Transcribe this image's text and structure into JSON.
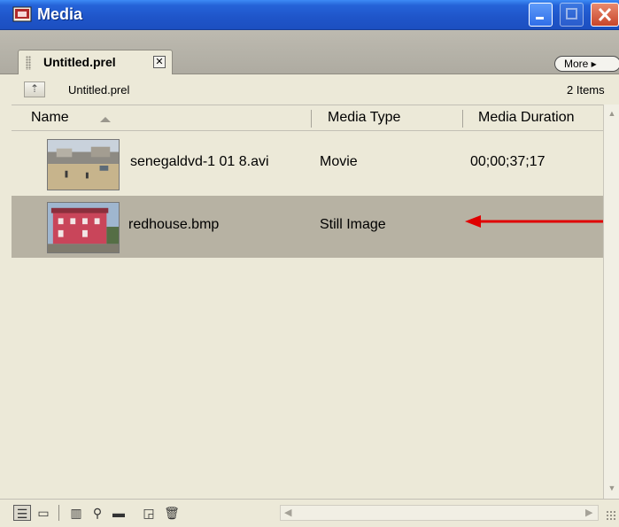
{
  "window": {
    "title": "Media"
  },
  "tabs": [
    {
      "label": "Untitled.prel",
      "close": "✕"
    }
  ],
  "menu": {
    "more_label": "More ▸"
  },
  "location": {
    "path": "Untitled.prel",
    "item_count": "2 Items"
  },
  "columns": {
    "name": "Name",
    "media_type": "Media Type",
    "media_duration": "Media Duration"
  },
  "items": [
    {
      "name": "senegaldvd-1 01 8.avi",
      "media_type": "Movie",
      "media_duration": "00;00;37;17",
      "selected": false
    },
    {
      "name": "redhouse.bmp",
      "media_type": "Still Image",
      "media_duration": "",
      "selected": true
    }
  ],
  "annotation": {
    "color": "#e00000"
  },
  "toolbar_icons": [
    "list-view-icon",
    "icon-view-icon",
    "storyboard-icon",
    "find-icon",
    "new-bin-icon",
    "new-item-icon",
    "trash-icon"
  ],
  "colors": {
    "title_bar": "#2563d8",
    "selection": "#b7b2a3",
    "panel": "#ece9d8"
  }
}
